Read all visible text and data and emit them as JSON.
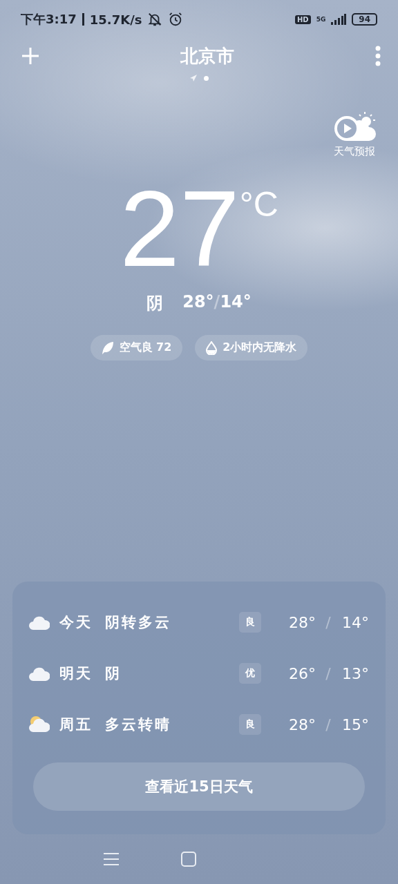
{
  "status_bar": {
    "time": "下午3:17",
    "speed": "15.7K/s",
    "battery": "94",
    "network": "5G",
    "hd": "HD"
  },
  "header": {
    "city": "北京市"
  },
  "forecast_video": {
    "label": "天气预报"
  },
  "current": {
    "temperature": "27",
    "unit": "°C",
    "condition": "阴",
    "high": "28°",
    "separator": "/",
    "low": "14°"
  },
  "chips": [
    {
      "kind": "air",
      "label": "空气良 72"
    },
    {
      "kind": "rain",
      "label": "2小时内无降水"
    }
  ],
  "days": [
    {
      "kind": "cloudy",
      "day": "今天",
      "condition": "阴转多云",
      "aqi": "良",
      "high": "28°",
      "separator": "/",
      "low": "14°"
    },
    {
      "kind": "cloudy",
      "day": "明天",
      "condition": "阴",
      "aqi": "优",
      "high": "26°",
      "separator": "/",
      "low": "13°"
    },
    {
      "kind": "sunny",
      "day": "周五",
      "condition": "多云转晴",
      "aqi": "良",
      "high": "28°",
      "separator": "/",
      "low": "15°"
    }
  ],
  "more_button": "查看近15日天气"
}
